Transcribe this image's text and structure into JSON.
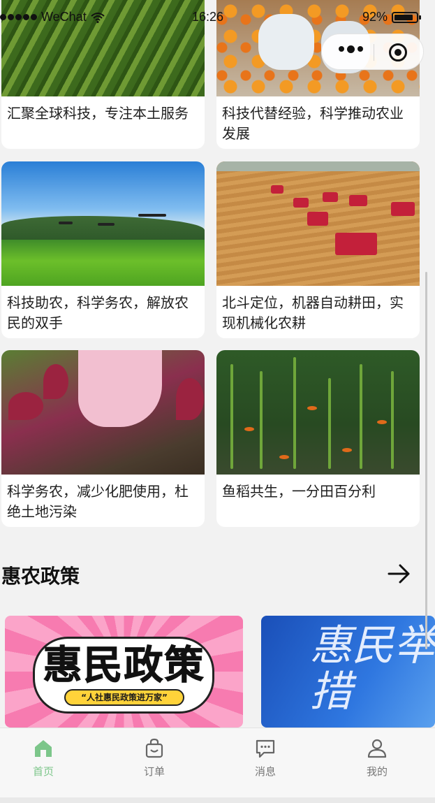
{
  "status_bar": {
    "carrier": "WeChat",
    "time": "16:26",
    "battery": "92%"
  },
  "articles": [
    {
      "title": "汇聚全球科技，专注本土服务",
      "image": "farmland-rows"
    },
    {
      "title": "科技代替经验，科学推动农业发展",
      "image": "orange-harvest"
    },
    {
      "title": "科技助农，科学务农，解放农民的双手",
      "image": "drone-spraying"
    },
    {
      "title": "北斗定位，机器自动耕田，实现机械化农耕",
      "image": "combine-harvesters"
    },
    {
      "title": "科学务农，减少化肥使用，杜绝土地污染",
      "image": "fertilizer-hand"
    },
    {
      "title": "鱼稻共生，一分田百分利",
      "image": "rice-fish-field"
    }
  ],
  "section": {
    "title": "惠农政策",
    "arrow_icon": "arrow-right-icon"
  },
  "banners": [
    {
      "title": "惠民政策",
      "subtitle": "“人社惠民政策进万家”"
    },
    {
      "title": "惠民举措"
    }
  ],
  "tabs": [
    {
      "label": "首页",
      "icon": "home-icon",
      "active": true
    },
    {
      "label": "订单",
      "icon": "shopping-bag-icon",
      "active": false
    },
    {
      "label": "消息",
      "icon": "message-icon",
      "active": false
    },
    {
      "label": "我的",
      "icon": "user-icon",
      "active": false
    }
  ],
  "colors": {
    "accent": "#7cc68a",
    "tab_inactive": "#777777",
    "background": "#f2f2f2"
  }
}
